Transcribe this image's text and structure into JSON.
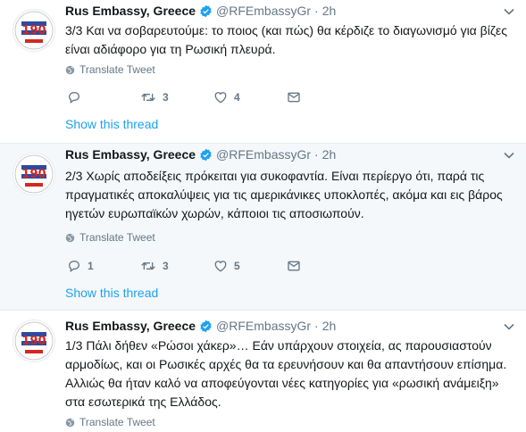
{
  "tweets": [
    {
      "author": {
        "name": "Rus Embassy, Greece",
        "handle": "@RFEmbassyGr"
      },
      "time": "2h",
      "text_lines": [
        "3/3 Και να σοβαρευτούμε: το ποιος (και πώς) θα κέρδιζε το διαγωνισμό για βίζες",
        "είναι αδιάφορο για τη Ρωσική πλευρά."
      ],
      "translate_label": "Translate Tweet",
      "reply_count": "",
      "retweet_count": "3",
      "like_count": "4",
      "show_thread": "Show this thread"
    },
    {
      "author": {
        "name": "Rus Embassy, Greece",
        "handle": "@RFEmbassyGr"
      },
      "time": "2h",
      "text_lines": [
        "2/3 Χωρίς αποδείξεις πρόκειται για συκοφαντία. Είναι περίεργο ότι, παρά  τις",
        "πραγματικές αποκαλύψεις για τις αμερικάνικες υποκλοπές, ακόμα και εις βάρος",
        "ηγετών ευρωπαϊκών χωρών, κάποιοι τις αποσιωπούν."
      ],
      "translate_label": "Translate Tweet",
      "reply_count": "1",
      "retweet_count": "3",
      "like_count": "5",
      "show_thread": "Show this thread"
    },
    {
      "author": {
        "name": "Rus Embassy, Greece",
        "handle": "@RFEmbassyGr"
      },
      "time": "2h",
      "text_lines": [
        "1/3 Πάλι δήθεν «Ρώσοι χάκερ»… Εάν υπάρχουν στοιχεία, ας παρουσιαστούν",
        "αρμοδίως, και οι Ρωσικές αρχές θα τα ερευνήσουν και θα απαντήσουν επίσημα.",
        "Αλλιώς θα ήταν καλό να αποφεύγονται νέες κατηγορίες για «ρωσική ανάμειξη»",
        "στα εσωτερικά της Ελλάδος."
      ],
      "translate_label": "Translate Tweet"
    }
  ],
  "colors": {
    "accent": "#1da1f2",
    "muted": "#657786",
    "text": "#14171a",
    "alt_bg": "#f5f8fa"
  },
  "icons": [
    "verified-badge-icon",
    "caret-down-icon",
    "globe-icon",
    "reply-icon",
    "retweet-icon",
    "like-icon",
    "dm-envelope-icon"
  ]
}
